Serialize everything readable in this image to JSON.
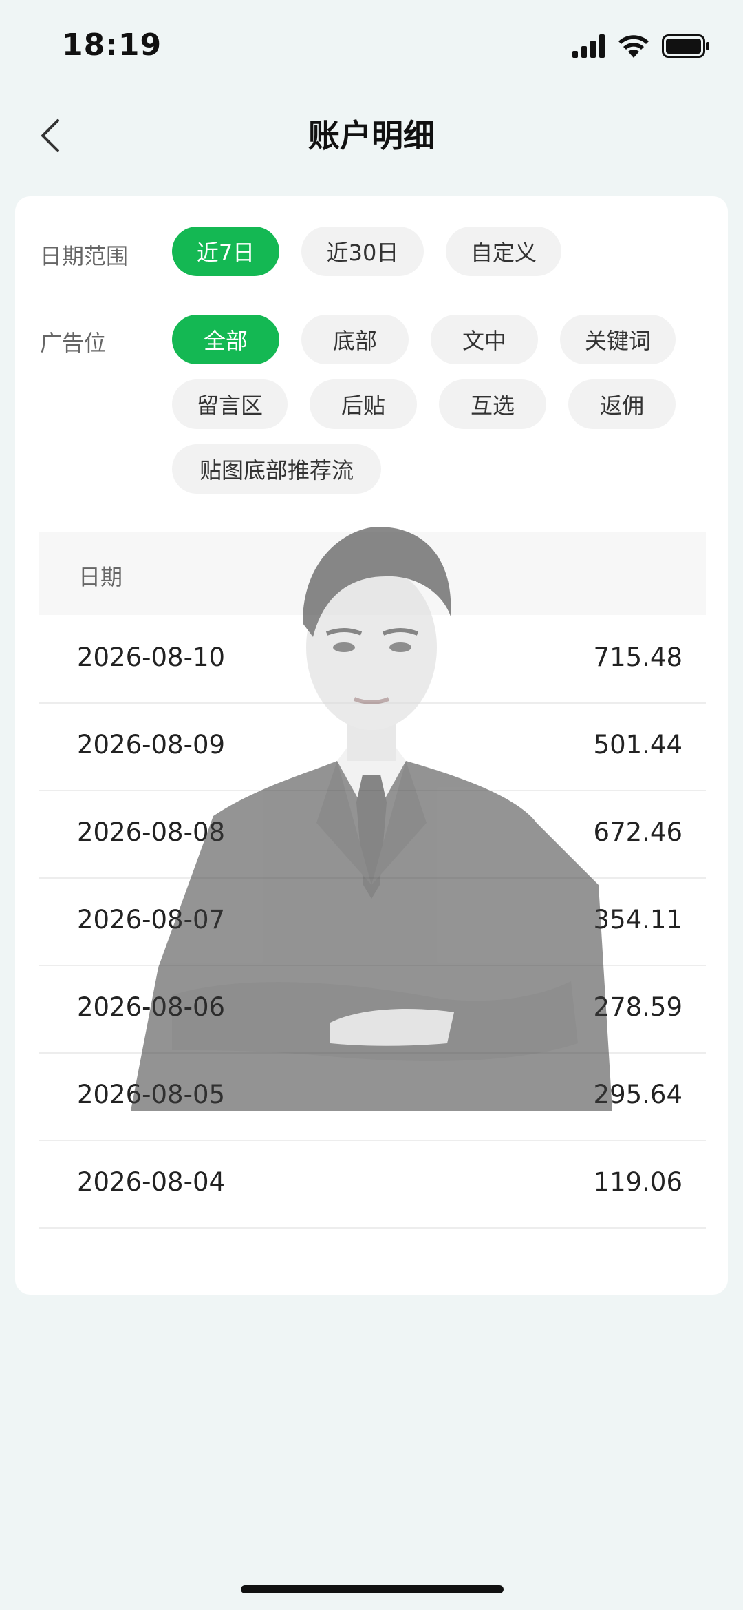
{
  "status_bar": {
    "time": "18:19"
  },
  "nav": {
    "title": "账户明细",
    "back_icon": "chevron-left-icon"
  },
  "filters": {
    "date_range": {
      "label": "日期范围",
      "options": [
        "近7日",
        "近30日",
        "自定义"
      ],
      "selected": "近7日"
    },
    "ad_position": {
      "label": "广告位",
      "options": [
        "全部",
        "底部",
        "文中",
        "关键词",
        "留言区",
        "后贴",
        "互选",
        "返佣",
        "贴图底部推荐流"
      ],
      "selected": "全部"
    }
  },
  "table": {
    "header": {
      "date": "日期"
    },
    "rows": [
      {
        "date": "2026-08-10",
        "value": "715.48"
      },
      {
        "date": "2026-08-09",
        "value": "501.44"
      },
      {
        "date": "2026-08-08",
        "value": "672.46"
      },
      {
        "date": "2026-08-07",
        "value": "354.11"
      },
      {
        "date": "2026-08-06",
        "value": "278.59"
      },
      {
        "date": "2026-08-05",
        "value": "295.64"
      },
      {
        "date": "2026-08-04",
        "value": "119.06"
      }
    ]
  },
  "colors": {
    "accent": "#14b853",
    "background": "#eff5f5",
    "card": "#ffffff"
  }
}
